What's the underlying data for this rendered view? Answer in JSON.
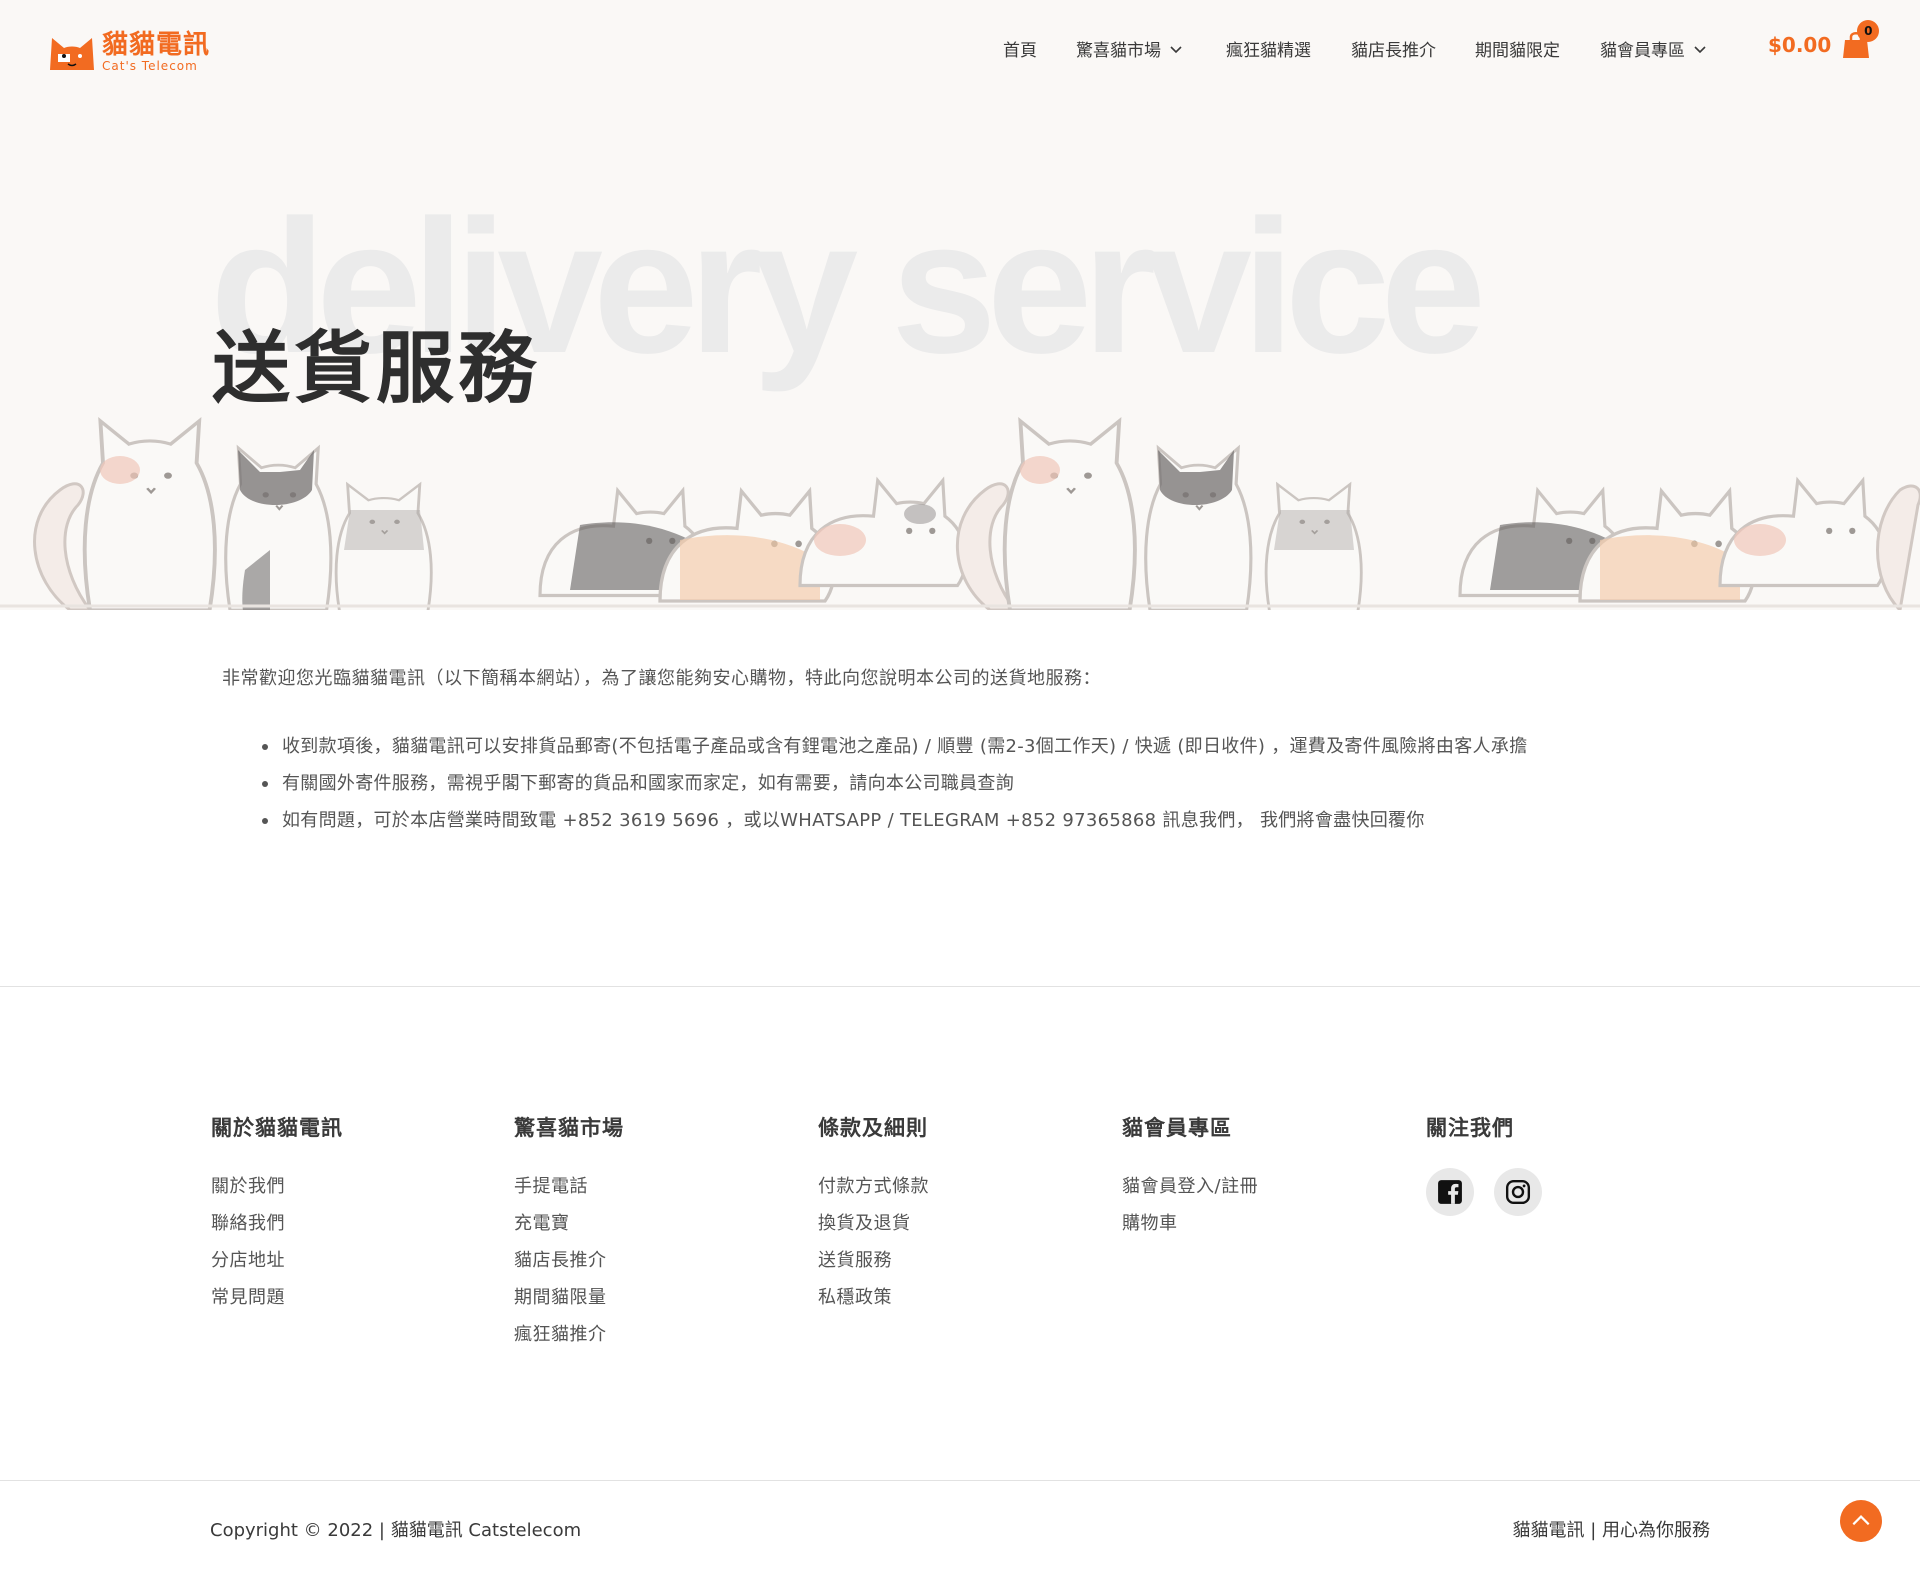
{
  "brand": {
    "name": "貓貓電訊",
    "sub": "Cat's Telecom",
    "accent": "#f26b21"
  },
  "nav": {
    "items": [
      {
        "label": "首頁",
        "has_dropdown": false
      },
      {
        "label": "驚喜貓市場",
        "has_dropdown": true
      },
      {
        "label": "瘋狂貓精選",
        "has_dropdown": false
      },
      {
        "label": "貓店長推介",
        "has_dropdown": false
      },
      {
        "label": "期間貓限定",
        "has_dropdown": false
      },
      {
        "label": "貓會員專區",
        "has_dropdown": true
      }
    ],
    "cart_total": "$0.00",
    "cart_count": "0"
  },
  "hero": {
    "bg_text": "delivery service",
    "title": "送貨服務"
  },
  "content": {
    "intro": "非常歡迎您光臨貓貓電訊（以下簡稱本網站），為了讓您能夠安心購物，特此向您說明本公司的送貨地服務：",
    "bullets": [
      "收到款項後，貓貓電訊可以安排貨品郵寄(不包括電子產品或含有鋰電池之產品) / 順豐 (需2-3個工作天)  / 快遞 (即日收件) ，運費及寄件風險將由客人承擔",
      "有關國外寄件服務，需視乎閣下郵寄的貨品和國家而家定，如有需要，請向本公司職員查詢",
      "如有問題，可於本店營業時間致電 +852 3619 5696  ，或以WHATSAPP  / TELEGRAM +852 97365868 訊息我們，  我們將會盡快回覆你"
    ]
  },
  "footer": {
    "columns": [
      {
        "heading": "關於貓貓電訊",
        "links": [
          "關於我們",
          "聯絡我們",
          "分店地址",
          "常見問題"
        ]
      },
      {
        "heading": "驚喜貓市場",
        "links": [
          "手提電話",
          "充電寶",
          "貓店長推介",
          "期間貓限量",
          "瘋狂貓推介"
        ]
      },
      {
        "heading": "條款及細則",
        "links": [
          "付款方式條款",
          "換貨及退貨",
          "送貨服務",
          "私穩政策"
        ]
      },
      {
        "heading": "貓會員專區",
        "links": [
          "貓會員登入/註冊",
          "購物車"
        ]
      }
    ],
    "social_heading": "關注我們",
    "social": [
      {
        "icon": "facebook-icon"
      },
      {
        "icon": "instagram-icon"
      }
    ],
    "copyright": "Copyright © 2022  |  貓貓電訊 Catstelecom",
    "tagline": "貓貓電訊 | 用心為你服務"
  }
}
